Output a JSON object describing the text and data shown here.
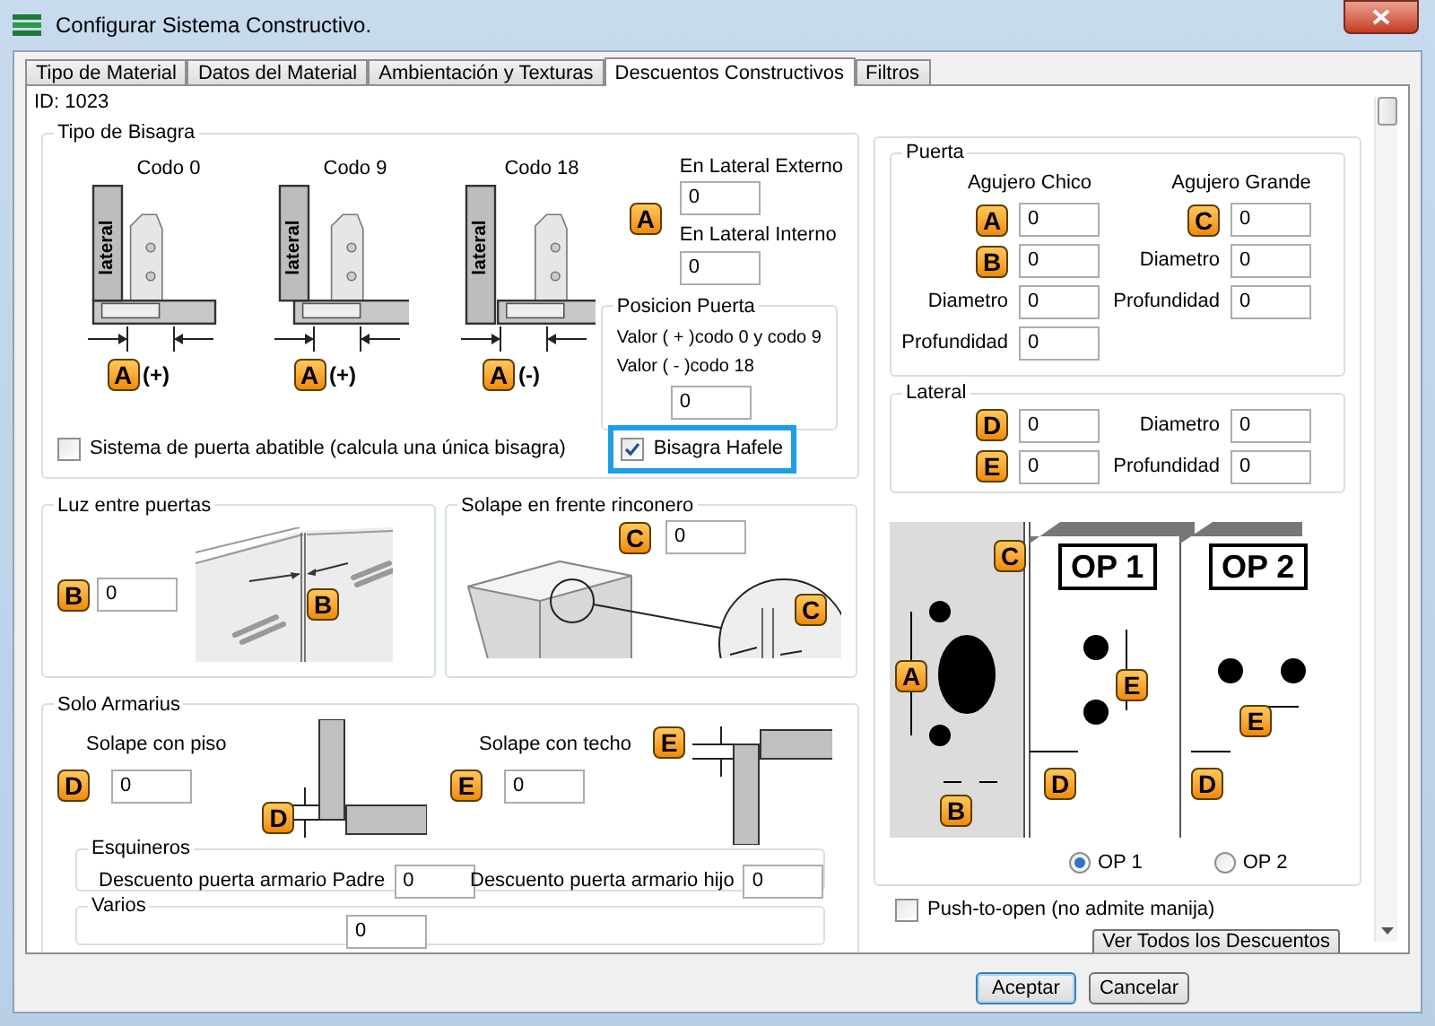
{
  "window": {
    "title": "Configurar Sistema Constructivo."
  },
  "tabs": [
    {
      "label": "Tipo de Material",
      "selected": false
    },
    {
      "label": "Datos del Material",
      "selected": false
    },
    {
      "label": "Ambientación y Texturas",
      "selected": false
    },
    {
      "label": "Descuentos Constructivos",
      "selected": true
    },
    {
      "label": "Filtros",
      "selected": false
    }
  ],
  "id_label": "ID: 1023",
  "hinge_type": {
    "title": "Tipo de Bisagra",
    "hinges": [
      {
        "label": "Codo 0",
        "kind": "full",
        "side_label": "lateral",
        "badge": "A",
        "sign": "(+)"
      },
      {
        "label": "Codo 9",
        "kind": "half",
        "side_label": "lateral",
        "badge": "A",
        "sign": "(+)"
      },
      {
        "label": "Codo 18",
        "kind": "inset",
        "side_label": "lateral",
        "badge": "A",
        "sign": "(-)"
      }
    ],
    "offset_badge": "A",
    "external": {
      "label": "En Lateral Externo",
      "value": "0"
    },
    "internal": {
      "label": "En Lateral Interno",
      "value": "0"
    },
    "door_position": {
      "title": "Posicion Puerta",
      "notes": [
        "Valor ( + )codo 0 y codo 9",
        "Valor ( - )codo 18"
      ],
      "value": "0"
    },
    "checkboxes": [
      {
        "label": "Sistema de puerta abatible (calcula una única bisagra)",
        "checked": false,
        "highlighted": false
      },
      {
        "label": "Bisagra Hafele",
        "checked": true,
        "highlighted": true
      }
    ]
  },
  "door_gap": {
    "title": "Luz entre puertas",
    "badge": "B",
    "value": "0",
    "figure_badge": "B"
  },
  "corner_overlap": {
    "title": "Solape en frente rinconero",
    "badge": "C",
    "value": "0",
    "figure_badge": "C"
  },
  "cabinets_only": {
    "title": "Solo Armarius",
    "floor": {
      "label": "Solape con piso",
      "badge": "D",
      "value": "0",
      "figure_badge": "D"
    },
    "ceiling": {
      "label": "Solape con techo",
      "badge": "E",
      "value": "0",
      "figure_badge": "E"
    },
    "corners": {
      "title": "Esquineros",
      "fields": [
        {
          "label": "Descuento puerta armario Padre",
          "value": "0"
        },
        {
          "label": "Descuento puerta armario hijo",
          "value": "0"
        }
      ]
    },
    "misc": {
      "title": "Varios",
      "value": "0"
    }
  },
  "door": {
    "title": "Puerta",
    "columns": [
      {
        "title": "Agujero Chico",
        "rows": [
          {
            "kind": "badge",
            "text": "A",
            "value": "0"
          },
          {
            "kind": "badge",
            "text": "B",
            "value": "0"
          },
          {
            "kind": "label",
            "text": "Diametro",
            "value": "0"
          },
          {
            "kind": "label",
            "text": "Profundidad",
            "value": "0"
          }
        ]
      },
      {
        "title": "Agujero Grande",
        "rows": [
          {
            "kind": "badge",
            "text": "C",
            "value": "0"
          },
          {
            "kind": "label",
            "text": "Diametro",
            "value": "0"
          },
          {
            "kind": "label",
            "text": "Profundidad",
            "value": "0"
          }
        ]
      }
    ]
  },
  "lateral": {
    "title": "Lateral",
    "rows": [
      {
        "kind": "badge",
        "text": "D",
        "value": "0"
      },
      {
        "kind": "label",
        "text": "Diametro",
        "value": "0"
      },
      {
        "kind": "badge",
        "text": "E",
        "value": "0"
      },
      {
        "kind": "label",
        "text": "Profundidad",
        "value": "0"
      }
    ]
  },
  "diagram": {
    "badge_top": "C",
    "badge_side": "A",
    "badge_bottom": "B",
    "panels": [
      {
        "title": "OP 1",
        "badge_spacing": "E",
        "badge_edge": "D"
      },
      {
        "title": "OP 2",
        "badge_spacing": "E",
        "badge_edge": "D"
      }
    ]
  },
  "options": [
    {
      "label": "OP 1",
      "selected": true
    },
    {
      "label": "OP 2",
      "selected": false
    }
  ],
  "push_to_open": {
    "label": "Push-to-open (no admite manija)",
    "checked": false
  },
  "show_all_button": "Ver Todos los Descuentos",
  "buttons": [
    {
      "label": "Aceptar",
      "default": true
    },
    {
      "label": "Cancelar",
      "default": false
    }
  ]
}
